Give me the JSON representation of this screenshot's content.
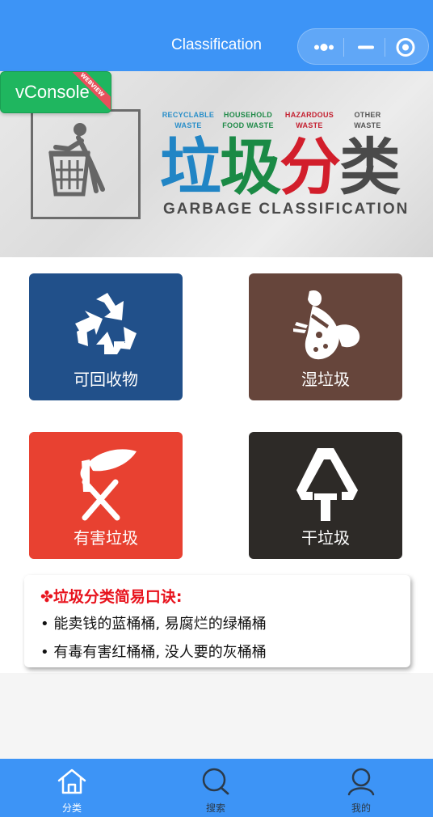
{
  "navbar": {
    "title": "Classification",
    "more_icon": "more-dots-icon",
    "minimize_icon": "minimize-icon",
    "close_icon": "target-close-icon"
  },
  "banner": {
    "categories": [
      {
        "line1": "RECYCLABLE",
        "line2": "WASTE",
        "color": "#2a8fc9"
      },
      {
        "line1": "HOUSEHOLD",
        "line2": "FOOD WASTE",
        "color": "#1f8a48"
      },
      {
        "line1": "HAZARDOUS",
        "line2": "WASTE",
        "color": "#c42030"
      },
      {
        "line1": "OTHER",
        "line2": "WASTE",
        "color": "#555555"
      }
    ],
    "title_chars": [
      {
        "char": "垃",
        "color": "#2185c5"
      },
      {
        "char": "圾",
        "color": "#1a8a45"
      },
      {
        "char": "分",
        "color": "#d21e2b"
      },
      {
        "char": "类",
        "color": "#4a4a4a"
      }
    ],
    "subtitle": "GARBAGE CLASSIFICATION",
    "icon": "person-trash-bin-icon"
  },
  "vconsole": {
    "label": "vConsole",
    "ribbon": "WEBVIEW"
  },
  "categories": [
    {
      "name": "可回收物",
      "color": "#21508a",
      "icon": "recycle-icon"
    },
    {
      "name": "湿垃圾",
      "color": "#66453b",
      "icon": "food-waste-icon"
    },
    {
      "name": "有害垃圾",
      "color": "#e84131",
      "icon": "hazardous-icon"
    },
    {
      "name": "干垃圾",
      "color": "#2d2a27",
      "icon": "dry-waste-icon"
    }
  ],
  "tips": {
    "title": "✤垃圾分类简易口诀:",
    "lines": [
      "• 能卖钱的蓝桶桶, 易腐烂的绿桶桶",
      "• 有毒有害红桶桶, 没人要的灰桶桶"
    ]
  },
  "tabbar": {
    "tabs": [
      {
        "label": "分类",
        "icon": "home-icon",
        "active": true
      },
      {
        "label": "搜索",
        "icon": "search-icon",
        "active": false
      },
      {
        "label": "我的",
        "icon": "user-icon",
        "active": false
      }
    ],
    "active_color": "#ffffff",
    "inactive_color": "#2b3a4a"
  }
}
